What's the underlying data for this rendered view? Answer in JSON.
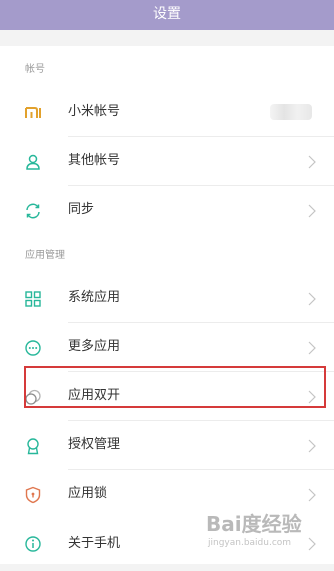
{
  "header": {
    "title": "设置"
  },
  "sections": {
    "account": {
      "title": "帐号",
      "items": [
        {
          "label": "小米帐号",
          "icon": "mi-logo-icon"
        },
        {
          "label": "其他帐号",
          "icon": "person-icon"
        },
        {
          "label": "同步",
          "icon": "sync-icon"
        }
      ]
    },
    "apps": {
      "title": "应用管理",
      "items": [
        {
          "label": "系统应用",
          "icon": "grid-icon"
        },
        {
          "label": "更多应用",
          "icon": "more-dots-icon"
        },
        {
          "label": "应用双开",
          "icon": "dual-app-icon"
        },
        {
          "label": "授权管理",
          "icon": "badge-icon"
        },
        {
          "label": "应用锁",
          "icon": "shield-lock-icon"
        }
      ]
    },
    "about": {
      "items": [
        {
          "label": "关于手机",
          "icon": "info-icon"
        }
      ]
    }
  },
  "watermark": {
    "main": "Bai度经验",
    "sub": "jingyan.baidu.com"
  },
  "colors": {
    "header_bg": "#a49bcb",
    "accent_green": "#27b79a",
    "accent_orange": "#e2a12c",
    "highlight_red": "#d53a3a"
  }
}
